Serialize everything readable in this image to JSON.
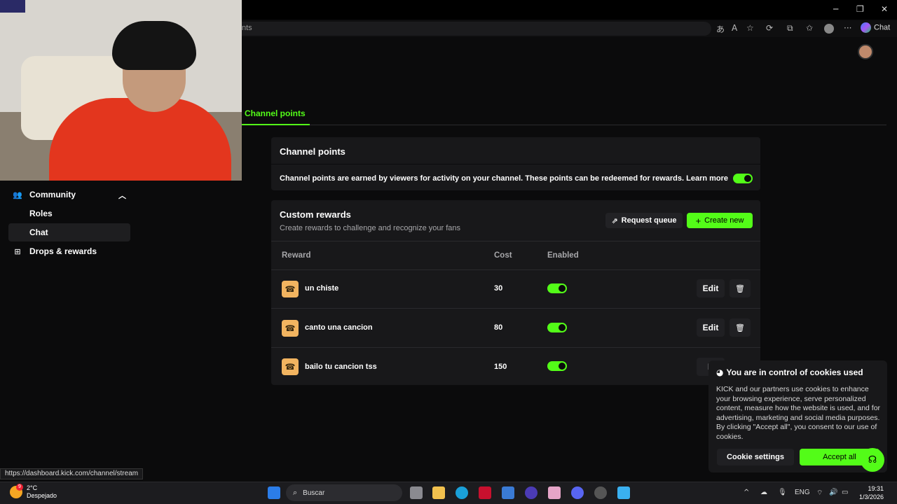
{
  "browser": {
    "addr_text": "nts",
    "chat_label": "Chat",
    "min": "─",
    "max": "❐",
    "close": "✕"
  },
  "tabs": {
    "active": "Channel points"
  },
  "sidebar": {
    "items": [
      {
        "label": "Community",
        "icon": "people-icon"
      },
      {
        "label": "Roles"
      },
      {
        "label": "Chat"
      },
      {
        "label": "Drops & rewards",
        "icon": "gift-icon"
      }
    ]
  },
  "channel_points": {
    "title": "Channel points",
    "description": "Channel points are earned by viewers for activity on your channel. These points can be redeemed for rewards. Learn more",
    "enabled": true
  },
  "custom_rewards": {
    "title": "Custom rewards",
    "subtitle": "Create rewards to challenge and recognize your fans",
    "request_queue": "Request queue",
    "create_new": "Create new",
    "headers": {
      "reward": "Reward",
      "cost": "Cost",
      "enabled": "Enabled"
    },
    "rows": [
      {
        "name": "un chiste",
        "cost": "30",
        "enabled": true,
        "edit": "Edit"
      },
      {
        "name": "canto una cancion",
        "cost": "80",
        "enabled": true,
        "edit": "Edit"
      },
      {
        "name": "bailo tu cancion tss",
        "cost": "150",
        "enabled": true,
        "edit": "E"
      }
    ]
  },
  "cookie": {
    "title": "You are in control of cookies used",
    "text": "KICK and our partners use cookies to enhance your browsing experience, serve personalized content, measure how the website is used, and for advertising, marketing and social media purposes. By clicking \"Accept all\", you consent to our use of cookies.",
    "settings": "Cookie settings",
    "accept": "Accept all"
  },
  "status_url": "https://dashboard.kick.com/channel/stream",
  "taskbar": {
    "temp": "2°C",
    "weather": "Despejado",
    "search": "Buscar",
    "lang": "ENG",
    "time": "19:31",
    "date": "1/3/2026"
  },
  "colors": {
    "accent": "#53fc18",
    "bg": "#0b0b0c",
    "card": "#18181a"
  }
}
